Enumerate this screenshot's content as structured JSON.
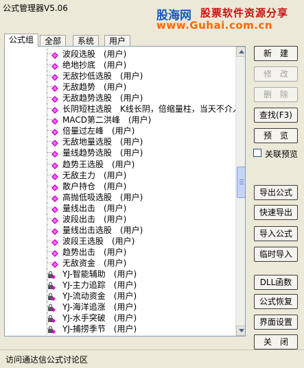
{
  "window": {
    "title": "公式管理器V5.06"
  },
  "banner": {
    "logo": "股海网",
    "slogan": "股票软件资源分享",
    "url": "www.Guhai.com.cn"
  },
  "tabs": [
    "公式组",
    "全部",
    "系统",
    "用户"
  ],
  "tree_items": [
    {
      "label": "波段选股",
      "tag": "(用户)",
      "kind": "user"
    },
    {
      "label": "绝地抄底",
      "tag": "(用户)",
      "kind": "user"
    },
    {
      "label": "无敌抄低选股",
      "tag": "(用户)",
      "kind": "user"
    },
    {
      "label": "无敌趋势",
      "tag": "(用户)",
      "kind": "user"
    },
    {
      "label": "无敌趋势选股",
      "tag": "(用户)",
      "kind": "user"
    },
    {
      "label": "长阴短柱选股",
      "tag": "K线长阴，倍缩量柱，当天不介入 (",
      "kind": "user"
    },
    {
      "label": "MACD第二洪峰",
      "tag": "(用户)",
      "kind": "user"
    },
    {
      "label": "倍量过左峰",
      "tag": "(用户)",
      "kind": "user"
    },
    {
      "label": "无敌地量选股",
      "tag": "(用户)",
      "kind": "user"
    },
    {
      "label": "量线趋势选股",
      "tag": "(用户)",
      "kind": "user"
    },
    {
      "label": "趋势王选股",
      "tag": "(用户)",
      "kind": "user"
    },
    {
      "label": "无敌主力",
      "tag": "(用户)",
      "kind": "user"
    },
    {
      "label": "散户持仓",
      "tag": "(用户)",
      "kind": "user"
    },
    {
      "label": "高抛低吸选股",
      "tag": "(用户)",
      "kind": "user"
    },
    {
      "label": "量线出击",
      "tag": "(用户)",
      "kind": "user"
    },
    {
      "label": "波段出击",
      "tag": "(用户)",
      "kind": "user"
    },
    {
      "label": "量线出击选股",
      "tag": "(用户)",
      "kind": "user"
    },
    {
      "label": "波段王选股",
      "tag": "(用户)",
      "kind": "user"
    },
    {
      "label": "趋势出击",
      "tag": "(用户)",
      "kind": "user"
    },
    {
      "label": "无敌资金",
      "tag": "(用户)",
      "kind": "user"
    },
    {
      "label": "YJ-智能辅助",
      "tag": "(用户)",
      "kind": "locked"
    },
    {
      "label": "YJ-主力追踪",
      "tag": "(用户)",
      "kind": "locked"
    },
    {
      "label": "YJ-流动资金",
      "tag": "(用户)",
      "kind": "locked"
    },
    {
      "label": "YJ-海洋追涨",
      "tag": "(用户)",
      "kind": "locked"
    },
    {
      "label": "YJ-水手突破",
      "tag": "(用户)",
      "kind": "locked"
    },
    {
      "label": "YJ-捕捞季节",
      "tag": "(用户)",
      "kind": "locked"
    }
  ],
  "buttons": {
    "new": "新　建",
    "modify": "修　改",
    "delete": "删　除",
    "find": "查找(F3)",
    "preview": "预　览",
    "export": "导出公式",
    "quick_export": "快速导出",
    "import": "导入公式",
    "temp_import": "临时导入",
    "dll": "DLL函数",
    "restore": "公式恢复",
    "ui_settings": "界面设置",
    "close": "关　闭"
  },
  "link_preview_label": "关联预览",
  "status_text": "访问通达信公式讨论区",
  "colors": {
    "icon_user": "#cc00cc",
    "scroll_thumb": "#c6d3f7"
  }
}
